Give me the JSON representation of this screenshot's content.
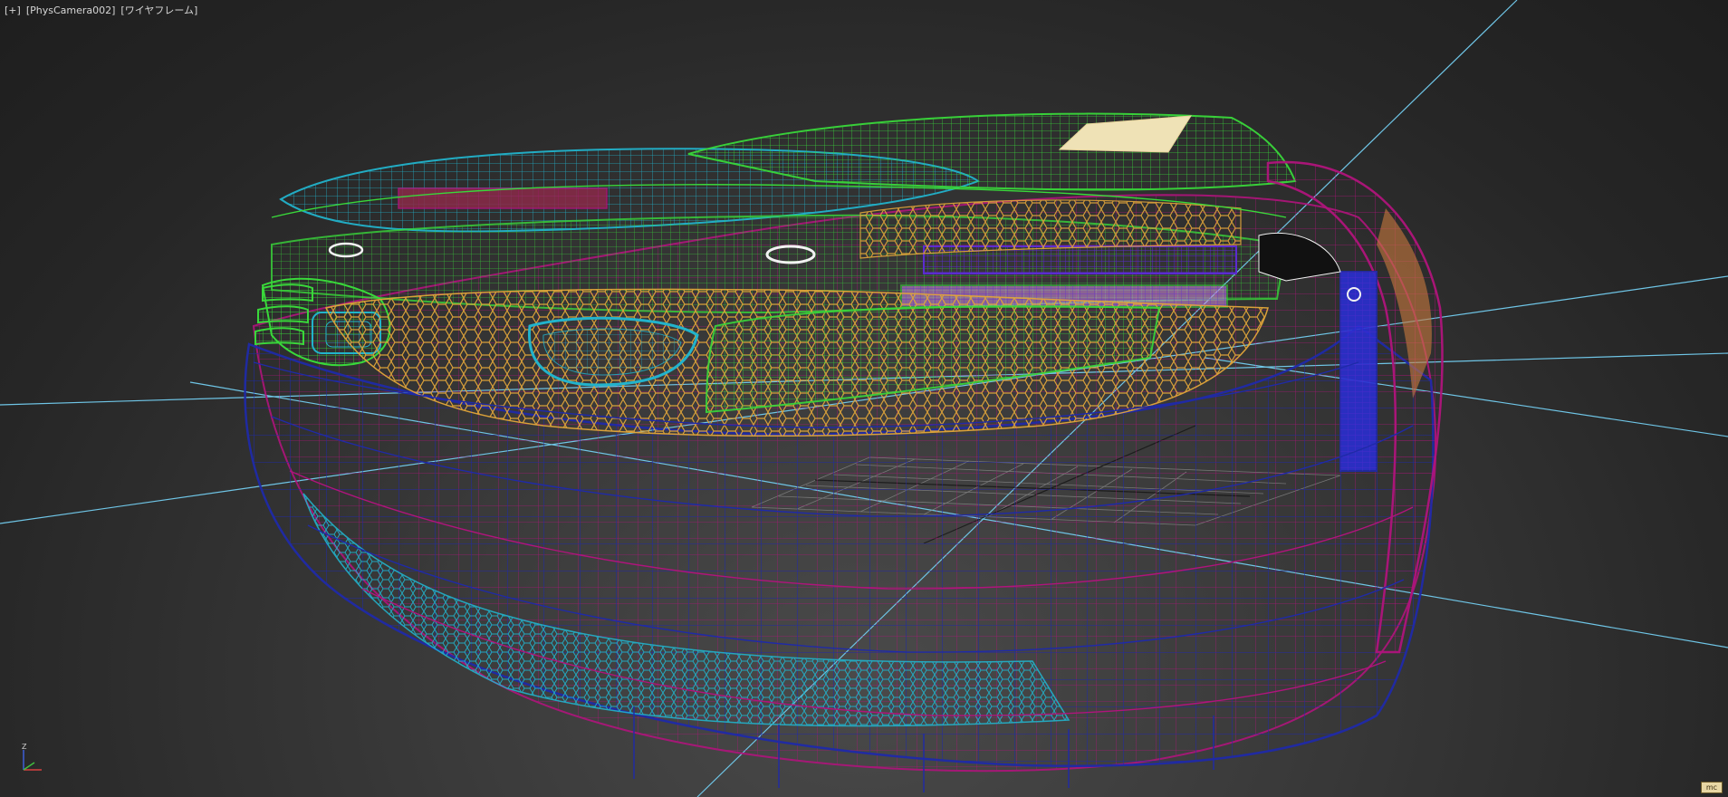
{
  "viewport": {
    "label_menu": "[+]",
    "label_camera": "[PhysCamera002]",
    "label_mode": "[ワイヤフレーム]",
    "axis_z": "Z",
    "badge": "mc"
  },
  "colors": {
    "background": "#333333",
    "grid_axis": "#6fc5e6",
    "wire_blue": "#1f2aa8",
    "wire_magenta": "#b0147c",
    "wire_cyan": "#22b3cc",
    "wire_green": "#39d83a",
    "wire_orange": "#e2a63a",
    "wire_purple": "#5b2bd0",
    "wire_white": "#f2f2f2"
  },
  "icons": [
    "axis-tripod-icon"
  ]
}
